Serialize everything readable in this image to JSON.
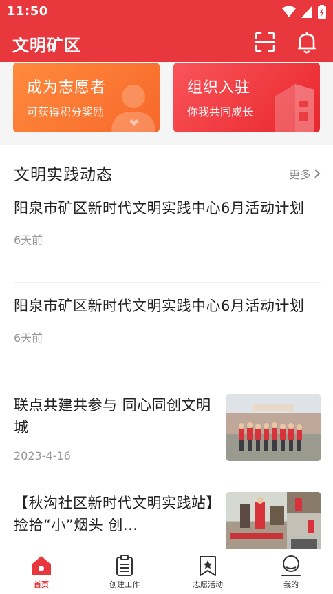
{
  "status_bar": {
    "time": "11:50"
  },
  "app_bar": {
    "title": "文明矿区"
  },
  "promo_cards": [
    {
      "title": "成为志愿者",
      "subtitle": "可获得积分奖励"
    },
    {
      "title": "组织入驻",
      "subtitle": "你我共同成长"
    }
  ],
  "section": {
    "title": "文明实践动态",
    "more_label": "更多"
  },
  "news": [
    {
      "title": "阳泉市矿区新时代文明实践中心6月活动计划",
      "date": "6天前"
    },
    {
      "title": "阳泉市矿区新时代文明实践中心6月活动计划",
      "date": "6天前"
    },
    {
      "title": "联点共建共参与 同心同创文明城",
      "date": "2023-4-16"
    },
    {
      "title": "【秋沟社区新时代文明实践站】捡拾“小”烟头 创...",
      "date": ""
    }
  ],
  "bottom_nav": [
    {
      "label": "首页",
      "icon": "home-icon",
      "active": true
    },
    {
      "label": "创建工作",
      "icon": "clipboard-icon",
      "active": false
    },
    {
      "label": "志愿活动",
      "icon": "bookmark-star-icon",
      "active": false
    },
    {
      "label": "我的",
      "icon": "profile-icon",
      "active": false
    }
  ],
  "colors": {
    "brand_red": "#e8373d",
    "volunteer_orange": "#f7682a",
    "org_red": "#e8262c"
  }
}
